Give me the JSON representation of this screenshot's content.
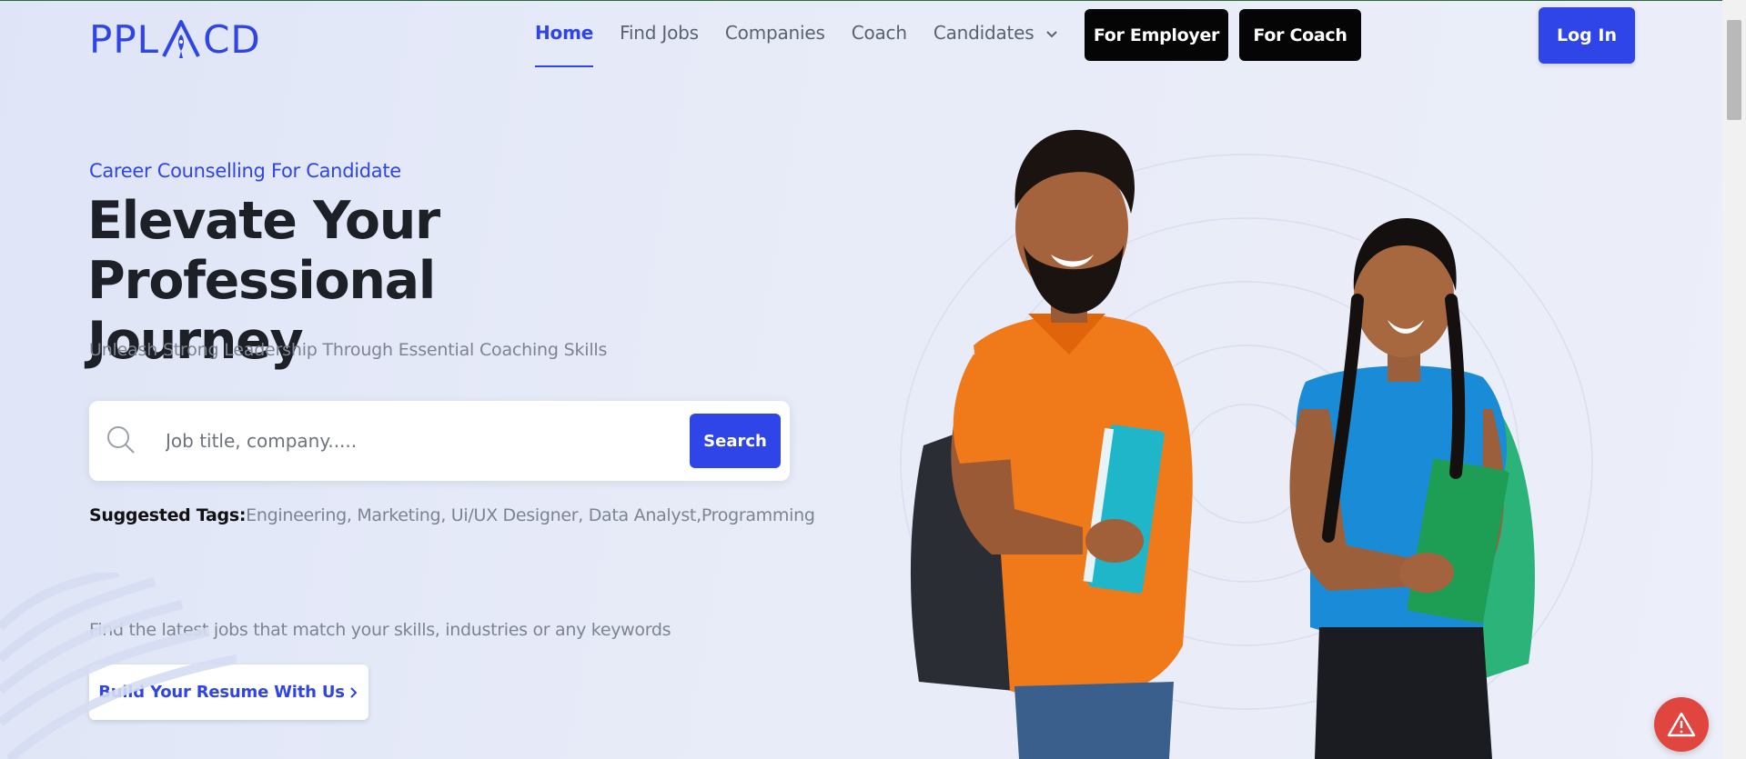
{
  "brand": {
    "logo_text_left": "PPL",
    "logo_text_right": "CD",
    "accent": "#2f45e8"
  },
  "nav": {
    "items": [
      {
        "label": "Home",
        "active": true
      },
      {
        "label": "Find Jobs",
        "active": false
      },
      {
        "label": "Companies",
        "active": false
      },
      {
        "label": "Coach",
        "active": false
      },
      {
        "label": "Candidates",
        "active": false,
        "has_dropdown": true
      }
    ],
    "for_employer": "For Employer",
    "for_coach": "For Coach",
    "login": "Log In"
  },
  "hero": {
    "eyebrow": "Career Counselling For Candidate",
    "headline_line1": "Elevate Your Professional",
    "headline_line2": "Journey",
    "subhead": "Unleash Strong Leadership Through Essential Coaching Skills",
    "search": {
      "placeholder": "Job title, company.....",
      "value": "",
      "button": "Search",
      "icon": "search-icon"
    },
    "tags": {
      "label": "Suggested Tags:",
      "items_text": "Engineering, Marketing, Ui/UX Designer, Data Analyst,Programming"
    },
    "find_latest": "Find the latest jobs that match your skills, industries or any keywords",
    "resume_button": "Build Your Resume With Us"
  },
  "icons": {
    "chevron": "chevron-down-icon",
    "alert": "warning-icon"
  },
  "colors": {
    "primary": "#2f45e8",
    "dark_button": "#050505",
    "alert": "#e0453f"
  }
}
